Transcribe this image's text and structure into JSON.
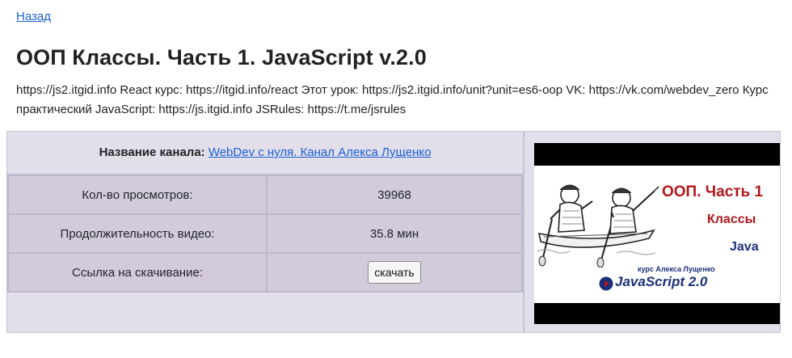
{
  "nav": {
    "back_label": "Назад"
  },
  "page": {
    "title": "ООП Классы. Часть 1. JavaScript v.2.0",
    "description": "https://js2.itgid.info React курс: https://itgid.info/react Этот урок: https://js2.itgid.info/unit?unit=es6-oop VK: https://vk.com/webdev_zero Курс практический JavaScript: https://js.itgid.info JSRules: https://t.me/jsrules"
  },
  "channel": {
    "label": "Название канала:",
    "name": "WebDev с нуля. Канал Алекса Лущенко"
  },
  "info": {
    "views_label": "Кол-во просмотров:",
    "views_value": "39968",
    "duration_label": "Продолжительность видео:",
    "duration_value": "35.8 мин",
    "download_label": "Ссылка на скачивание:",
    "download_button": "скачать"
  },
  "thumbnail": {
    "title": "ООП. Часть 1",
    "subtitle": "Классы",
    "language": "Java",
    "author": "курс Алекса Лущенко",
    "course": "JavaScript 2.0"
  },
  "colors": {
    "link": "#1a5fd6",
    "card_bg": "#e2dfea",
    "cell_bg": "#d3cbdc",
    "thumb_accent": "#b0171c",
    "thumb_navy": "#1a2f7a"
  }
}
